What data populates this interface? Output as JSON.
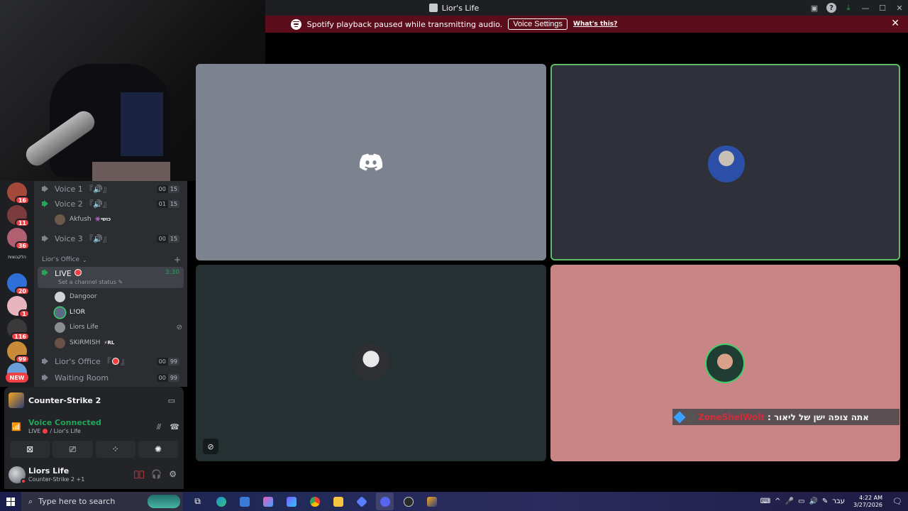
{
  "window": {
    "title": "Lior's Life"
  },
  "banner": {
    "text": "Spotify playback paused while transmitting audio.",
    "button": "Voice Settings",
    "link": "What's this?"
  },
  "servers": {
    "badges": [
      "16",
      "11",
      "36",
      "20",
      "1",
      "116",
      "99"
    ],
    "folder_label": "הלקבוצות",
    "new_label": "NEW"
  },
  "channels": {
    "voice1": {
      "name": "Voice 1 『🔊』",
      "count_a": "00",
      "count_b": "15"
    },
    "voice2": {
      "name": "Voice 2 『🔊』",
      "count_a": "01",
      "count_b": "15"
    },
    "voice2_user": {
      "name": "Akfush",
      "tag": "👾כושי"
    },
    "voice3": {
      "name": "Voice 3 『🔊』",
      "count_a": "00",
      "count_b": "15"
    },
    "category": "Lior's Office",
    "live": {
      "name": "LIVE",
      "timer": "3:30",
      "status": "Set a channel status"
    },
    "live_users": [
      {
        "name": "Dangoor",
        "tag": ""
      },
      {
        "name": "L!OR",
        "tag": ""
      },
      {
        "name": "Liors Life",
        "tag": ""
      },
      {
        "name": "SKIRMISH",
        "tag": "⚡RL"
      }
    ],
    "office": {
      "name": "Lior's Office 『",
      "suffix": "』",
      "count_a": "00",
      "count_b": "99"
    },
    "waiting": {
      "name": "Waiting Room",
      "count_a": "00",
      "count_b": "99"
    }
  },
  "activity": {
    "game": "Counter-Strike 2",
    "voice_status": "Voice Connected",
    "voice_sub_live": "LIVE",
    "voice_sub_server": "/ Lior's Life"
  },
  "user": {
    "name": "Liors Life",
    "activity": "Counter-Strike 2 +1"
  },
  "overlay": {
    "username": "ZoneShelWolt",
    "message": ": אתה צופה ישן של ליאור"
  },
  "taskbar": {
    "search_placeholder": "Type here to search",
    "language": "עבר",
    "time": "4:22 AM",
    "date": "3/27/2026"
  },
  "colors": {
    "accent_green": "#23a55a",
    "danger": "#f23f43",
    "banner": "#5c0d1c",
    "tile_speaking_border": "#5dbb63"
  }
}
